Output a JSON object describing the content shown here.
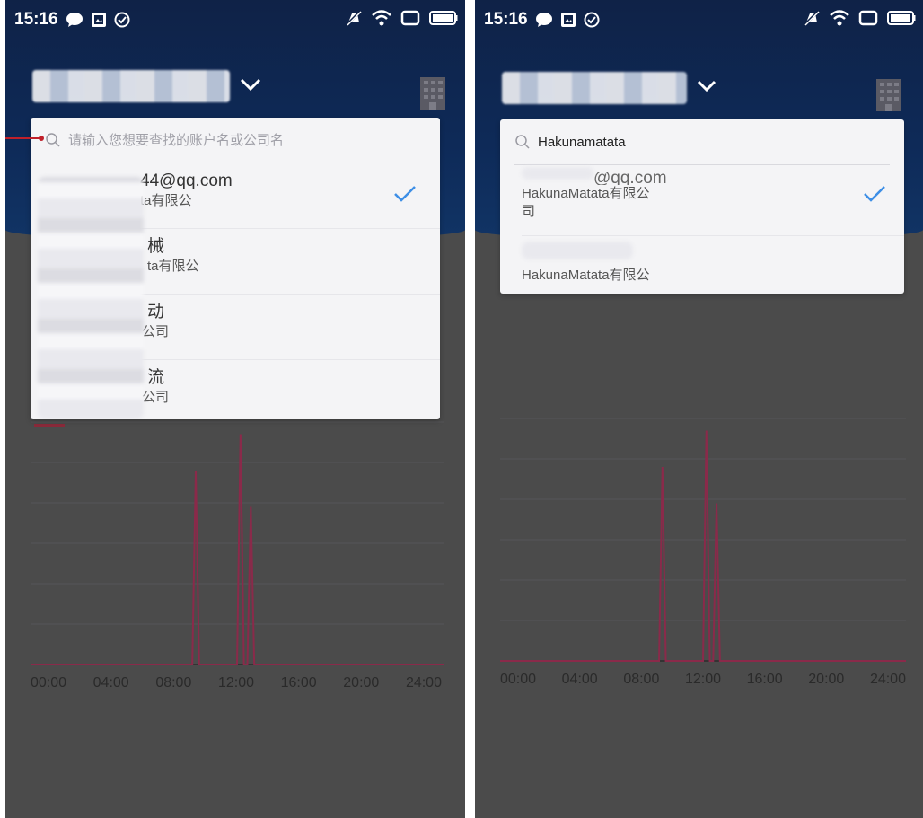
{
  "status": {
    "time": "15:16",
    "icons": [
      "chat-bubble-icon",
      "gallery-icon",
      "check-circle-icon",
      "mute-icon",
      "wifi-icon",
      "square-icon",
      "battery-icon"
    ]
  },
  "left_screen": {
    "search": {
      "placeholder": "请输入您想要查找的账户名或公司名",
      "value": ""
    },
    "accounts": [
      {
        "title": "44@qq.com",
        "sub": "ta有限公",
        "selected": true
      },
      {
        "title": "械",
        "sub": "ta有限公",
        "selected": false
      },
      {
        "title": "动",
        "sub": "公司",
        "selected": false
      },
      {
        "title": "流",
        "sub": "公司",
        "selected": false
      }
    ]
  },
  "right_screen": {
    "search": {
      "placeholder": "",
      "value": "Hakunamatata"
    },
    "accounts": [
      {
        "title": "@qq.com",
        "sub": "HakunaMatata有限公",
        "sub2": "司",
        "selected": true
      },
      {
        "title": "",
        "sub": "HakunaMatata有限公",
        "sub2": "",
        "selected": false
      }
    ]
  },
  "chart_data": {
    "type": "line",
    "x_ticks": [
      "00:00",
      "04:00",
      "08:00",
      "12:00",
      "16:00",
      "20:00",
      "24:00"
    ],
    "x": [
      0,
      9.4,
      9.6,
      9.8,
      12.0,
      12.2,
      12.4,
      12.6,
      12.8,
      13.0,
      24
    ],
    "values": [
      0,
      0,
      0.8,
      0,
      0,
      0.95,
      0,
      0,
      0.65,
      0,
      0
    ],
    "xlim": [
      0,
      24
    ],
    "ylim": [
      0,
      1
    ],
    "grid": true,
    "line_color": "#8a2a4a"
  },
  "colors": {
    "header": "#0f2247",
    "overlay": "#4b4b4b",
    "dropdown": "#f4f4f6",
    "check": "#3d8ee6"
  }
}
